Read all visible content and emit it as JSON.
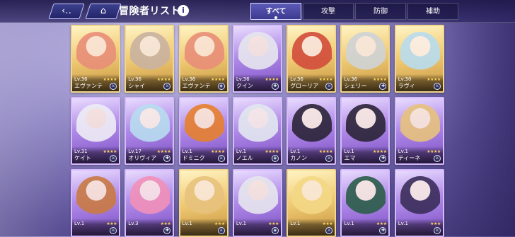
{
  "header": {
    "back_icon": "back-arrow-icon",
    "home_icon": "home-icon",
    "title": "冒険者リスト",
    "info_label": "i"
  },
  "tabs": [
    {
      "label": "すべて",
      "active": true
    },
    {
      "label": "攻撃",
      "active": false
    },
    {
      "label": "防御",
      "active": false
    },
    {
      "label": "補助",
      "active": false
    }
  ],
  "cards": [
    {
      "lv": "Lv.36",
      "name": "エヴァンテ",
      "rarity": 4,
      "frame": "gold",
      "role_icon": "role-attack-icon"
    },
    {
      "lv": "Lv.36",
      "name": "シャイ",
      "rarity": 4,
      "frame": "gold",
      "role_icon": "role-attack-icon"
    },
    {
      "lv": "Lv.36",
      "name": "エヴァンテ",
      "rarity": 4,
      "frame": "gold",
      "role_icon": "role-defense-icon"
    },
    {
      "lv": "Lv.36",
      "name": "クイン",
      "rarity": 4,
      "frame": "purple",
      "role_icon": "role-support-icon"
    },
    {
      "lv": "Lv.36",
      "name": "グローリア",
      "rarity": 4,
      "frame": "gold",
      "role_icon": "role-attack-icon"
    },
    {
      "lv": "Lv.36",
      "name": "シェリー",
      "rarity": 4,
      "frame": "gold",
      "role_icon": "role-support-icon"
    },
    {
      "lv": "Lv.30",
      "name": "ラヴィ",
      "rarity": 4,
      "frame": "gold",
      "role_icon": "role-attack-icon"
    },
    {
      "lv": "Lv.31",
      "name": "ケイト",
      "rarity": 4,
      "frame": "purple",
      "role_icon": "role-attack-icon"
    },
    {
      "lv": "Lv.17",
      "name": "オリヴィア",
      "rarity": 4,
      "frame": "purple",
      "role_icon": "role-support-icon"
    },
    {
      "lv": "Lv.1",
      "name": "ドミニク",
      "rarity": 4,
      "frame": "purple",
      "role_icon": "role-attack-icon"
    },
    {
      "lv": "Lv.1",
      "name": "ノエル",
      "rarity": 4,
      "frame": "purple",
      "role_icon": "role-defense-icon"
    },
    {
      "lv": "Lv.1",
      "name": "カノン",
      "rarity": 4,
      "frame": "purple",
      "role_icon": "role-attack-icon"
    },
    {
      "lv": "Lv.1",
      "name": "エマ",
      "rarity": 4,
      "frame": "purple",
      "role_icon": "role-support-icon"
    },
    {
      "lv": "Lv.1",
      "name": "ティーネ",
      "rarity": 4,
      "frame": "purple",
      "role_icon": "role-attack-icon"
    },
    {
      "lv": "Lv.1",
      "name": "",
      "rarity": 3,
      "frame": "purple",
      "role_icon": "role-attack-icon"
    },
    {
      "lv": "Lv.3",
      "name": "",
      "rarity": 3,
      "frame": "purple",
      "role_icon": "role-support-icon"
    },
    {
      "lv": "Lv.1",
      "name": "",
      "rarity": 3,
      "frame": "gold",
      "role_icon": "role-attack-icon"
    },
    {
      "lv": "Lv.1",
      "name": "",
      "rarity": 3,
      "frame": "purple",
      "role_icon": "role-defense-icon"
    },
    {
      "lv": "Lv.1",
      "name": "",
      "rarity": 3,
      "frame": "gold",
      "role_icon": "role-attack-icon"
    },
    {
      "lv": "Lv.1",
      "name": "",
      "rarity": 3,
      "frame": "purple",
      "role_icon": "role-support-icon"
    },
    {
      "lv": "Lv.1",
      "name": "",
      "rarity": 3,
      "frame": "purple",
      "role_icon": "role-attack-icon"
    }
  ]
}
